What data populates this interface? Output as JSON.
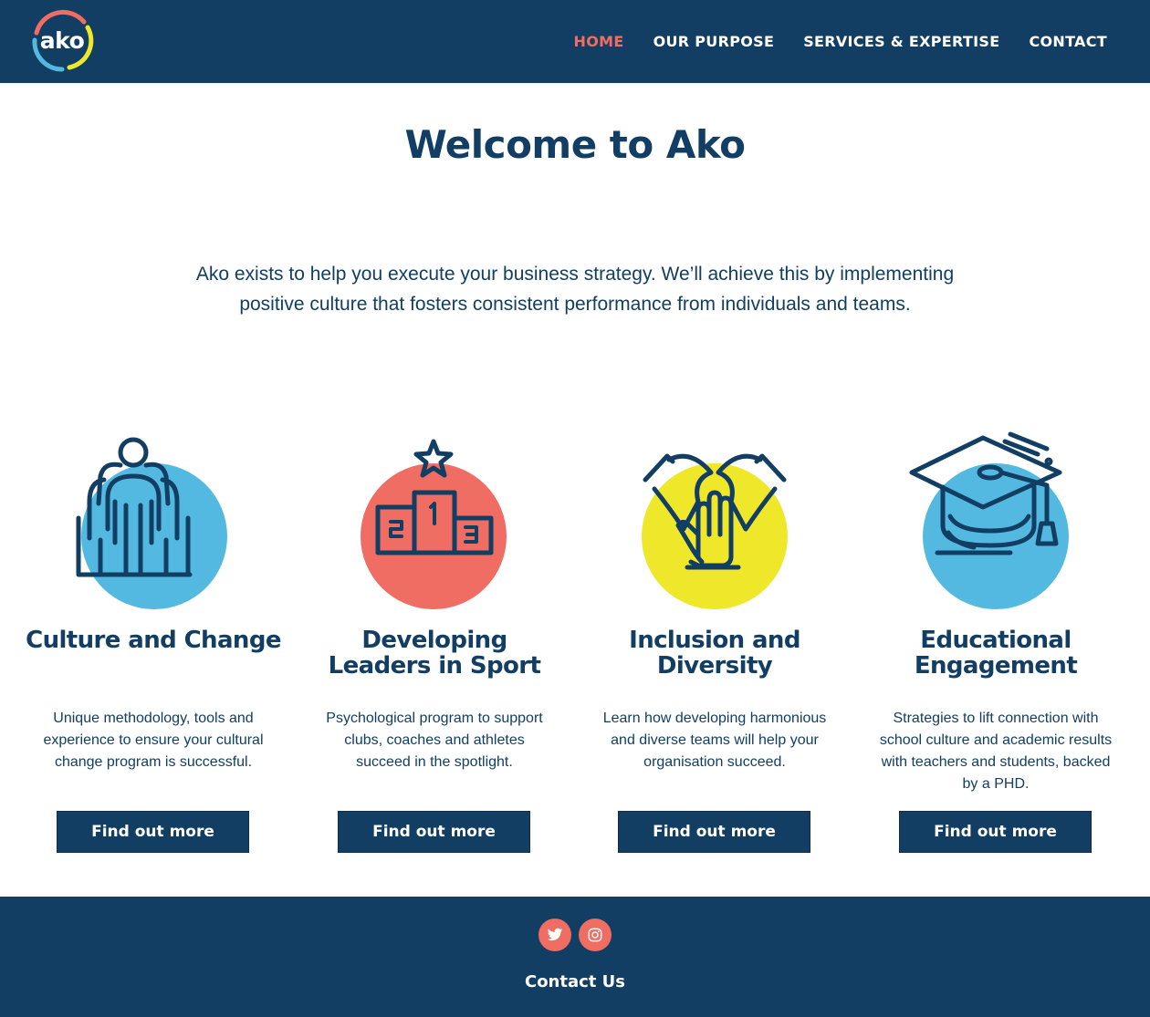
{
  "brand": {
    "logo_text": "ako"
  },
  "nav": {
    "items": [
      {
        "label": "HOME",
        "active": true
      },
      {
        "label": "OUR PURPOSE",
        "active": false
      },
      {
        "label": "SERVICES & EXPERTISE",
        "active": false
      },
      {
        "label": "CONTACT",
        "active": false
      }
    ]
  },
  "main": {
    "title": "Welcome to Ako",
    "intro_line1": "Ako exists to help you execute your business strategy. We’ll achieve this by implementing",
    "intro_line2": "positive culture that fosters consistent performance from individuals and teams."
  },
  "cards": [
    {
      "icon": "people-group-icon",
      "circle_color": "#54b9e1",
      "title_line1": "Culture and Change",
      "title_line2": "",
      "desc": "Unique methodology, tools and experience to ensure your cultural change program is successful.",
      "button": "Find out more"
    },
    {
      "icon": "podium-icon",
      "circle_color": "#ef6d63",
      "title_line1": "Developing",
      "title_line2": "Leaders in Sport",
      "desc": "Psychological program to support clubs, coaches and athletes succeed in the spotlight.",
      "button": "Find out more"
    },
    {
      "icon": "hands-together-icon",
      "circle_color": "#efe82a",
      "title_line1": "Inclusion and",
      "title_line2": "Diversity",
      "desc": "Learn how developing harmonious and diverse teams will help your organisation succeed.",
      "button": "Find out more"
    },
    {
      "icon": "graduation-cap-icon",
      "circle_color": "#54b9e1",
      "title_line1": "Educational",
      "title_line2": "Engagement",
      "desc": "Strategies to lift connection with school culture and academic results with teachers and students, backed by a PHD.",
      "button": "Find out more"
    }
  ],
  "footer": {
    "social": [
      "twitter-icon",
      "instagram-icon"
    ],
    "contact_label": "Contact Us"
  },
  "colors": {
    "navy": "#123e63",
    "coral": "#ef6d63",
    "sky": "#54b9e1",
    "yellow": "#efe82a"
  }
}
